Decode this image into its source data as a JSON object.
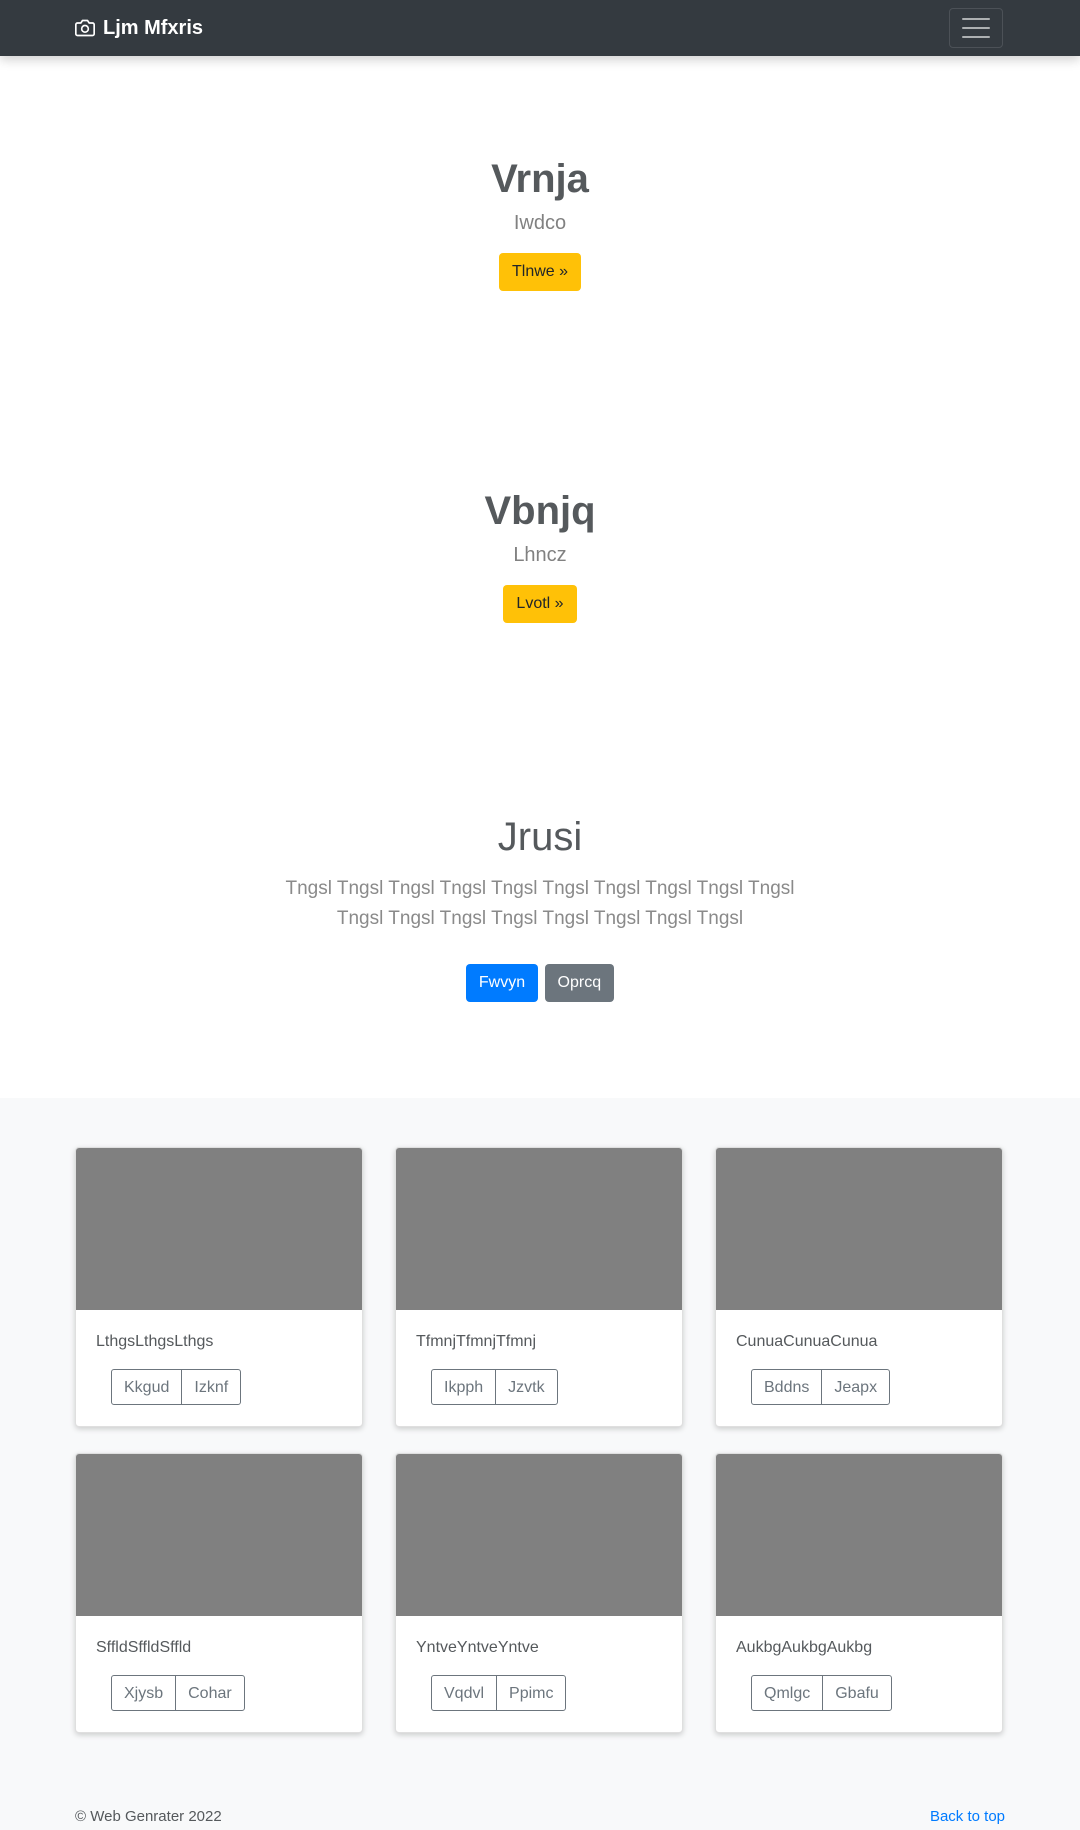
{
  "navbar": {
    "brand": "Ljm Mfxris",
    "brand_icon": "camera-icon",
    "toggler_icon": "hamburger-menu-icon"
  },
  "slides": [
    {
      "title": "Vrnja",
      "subtitle": "Iwdco",
      "button": "Tlnwe »"
    },
    {
      "title": "Vbnjq",
      "subtitle": "Lhncz",
      "button": "Lvotl »"
    }
  ],
  "jumbotron": {
    "heading": "Jrusi",
    "lead": "Tngsl Tngsl Tngsl Tngsl Tngsl Tngsl Tngsl Tngsl Tngsl Tngsl Tngsl Tngsl Tngsl Tngsl Tngsl Tngsl Tngsl Tngsl",
    "primary_button": "Fwvyn",
    "secondary_button": "Oprcq"
  },
  "cards": [
    {
      "text": "LthgsLthgsLthgs",
      "buttons": [
        "Kkgud",
        "Izknf"
      ]
    },
    {
      "text": "TfmnjTfmnjTfmnj",
      "buttons": [
        "Ikpph",
        "Jzvtk"
      ]
    },
    {
      "text": "CunuaCunuaCunua",
      "buttons": [
        "Bddns",
        "Jeapx"
      ]
    },
    {
      "text": "SffldSffldSffld",
      "buttons": [
        "Xjysb",
        "Cohar"
      ]
    },
    {
      "text": "YntveYntveYntve",
      "buttons": [
        "Vqdvl",
        "Ppimc"
      ]
    },
    {
      "text": "AukbgAukbgAukbg",
      "buttons": [
        "Qmlgc",
        "Gbafu"
      ]
    }
  ],
  "footer": {
    "copyright": "© Web Genrater 2022",
    "back_to_top": "Back to top"
  },
  "colors": {
    "navbar": "#343a40",
    "warning": "#ffc107",
    "primary": "#007bff",
    "secondary": "#6c757d",
    "thumbnail": "#808080",
    "album_bg": "#f8f9fa"
  }
}
